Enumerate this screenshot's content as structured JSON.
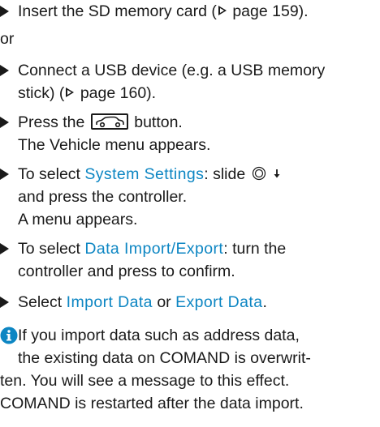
{
  "steps": [
    {
      "pre": "Insert the SD memory card (",
      "ref": "page 159",
      "post": ")."
    },
    {
      "or": "or"
    },
    {
      "line1": "Connect a USB device (e.g. a USB memory",
      "line2_pre": "stick) (",
      "ref": "page 160",
      "line2_post": ")."
    },
    {
      "pre": "Press the",
      "post": "button.",
      "result": "The Vehicle menu appears."
    },
    {
      "pre": "To select ",
      "term": "System Settings",
      "mid": ": slide",
      "line2": "and press the controller.",
      "result": "A menu appears."
    },
    {
      "pre": "To select ",
      "term": "Data Import/Export",
      "post": ": turn the",
      "line2": "controller and press to confirm."
    },
    {
      "pre": "Select ",
      "term1": "Import Data",
      "mid": " or ",
      "term2": "Export Data",
      "post": "."
    }
  ],
  "note": {
    "lines": [
      "If you import data such as address data,",
      "the existing data on COMAND is overwrit-",
      "ten. You will see a message to this effect.",
      "COMAND is restarted after the data import."
    ]
  },
  "colors": {
    "text": "#1a1a1a",
    "term": "#0d86c3",
    "info": "#0d86c3"
  },
  "icons": {
    "bullet": "action-triangle-icon",
    "ref": "page-reference-icon",
    "vehicle": "vehicle-button-icon",
    "controller": "controller-icon",
    "slide_down": "slide-down-arrow-icon",
    "info": "info-icon"
  }
}
